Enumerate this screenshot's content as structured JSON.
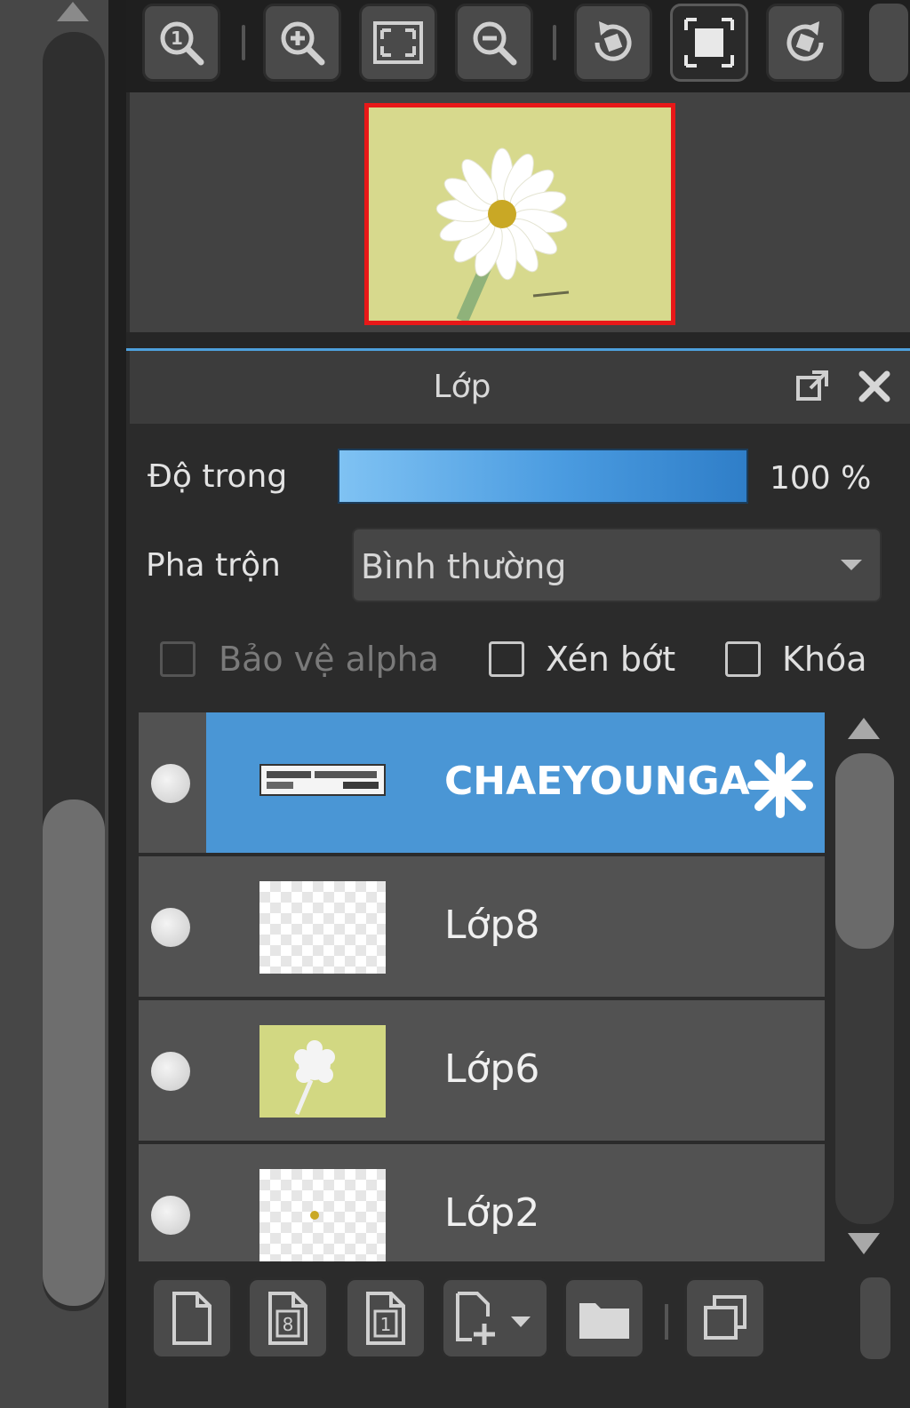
{
  "toolbar": {
    "buttons": [
      {
        "icon": "zoom-actual-icon"
      },
      {
        "icon": "zoom-in-icon"
      },
      {
        "icon": "fit-screen-icon"
      },
      {
        "icon": "zoom-out-icon"
      },
      {
        "icon": "rotate-left-icon"
      },
      {
        "icon": "reset-rotation-icon"
      },
      {
        "icon": "rotate-right-icon"
      }
    ]
  },
  "layer_panel": {
    "title": "Lớp",
    "opacity_label": "Độ trong",
    "opacity_value": "100 %",
    "opacity_fraction": 1.0,
    "blend_label": "Pha trộn",
    "blend_value": "Bình thường",
    "protect_alpha_label": "Bảo vệ alpha",
    "clipping_label": "Xén bớt",
    "lock_label": "Khóa"
  },
  "layers": [
    {
      "name": "CHAEYOUNGA",
      "selected": true
    },
    {
      "name": "Lớp8",
      "selected": false
    },
    {
      "name": "Lớp6",
      "selected": false
    },
    {
      "name": "Lớp2",
      "selected": false
    }
  ],
  "colors": {
    "selection": "#4a96d5",
    "navigator_frame": "#e81818",
    "canvas_bg": "#d7d98d"
  }
}
